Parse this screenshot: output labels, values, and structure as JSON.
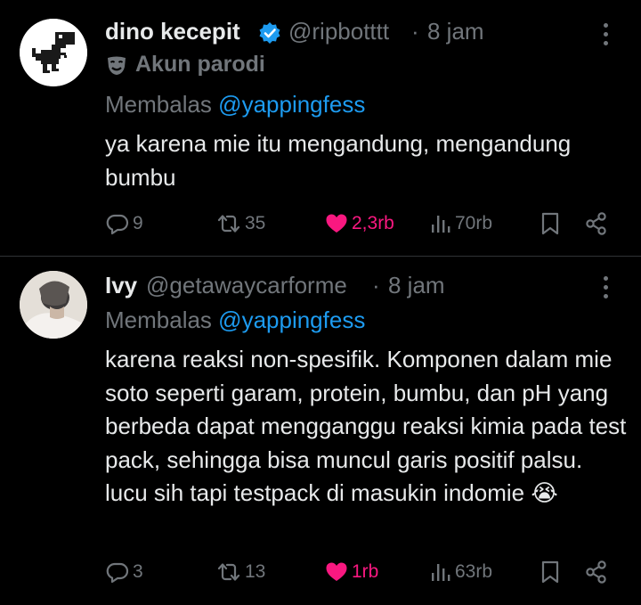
{
  "tweets": [
    {
      "name": "dino kecepit",
      "handle": "@ripbotttt",
      "separator": "·",
      "time": "8 jam",
      "verified": true,
      "label": "Akun parodi",
      "reply_prefix": "Membalas",
      "reply_to": "@yappingfess",
      "text": "ya karena mie itu mengandung, mengandung bumbu",
      "replies": "9",
      "retweets": "35",
      "likes": "2,3rb",
      "views": "70rb",
      "liked": true
    },
    {
      "name": "Ivy",
      "handle": "@getawaycarforme",
      "separator": "·",
      "time": "8 jam",
      "verified": false,
      "reply_prefix": "Membalas",
      "reply_to": "@yappingfess",
      "text": "karena reaksi non-spesifik. Komponen dalam mie soto seperti garam, protein, bumbu, dan pH yang berbeda dapat mengganggu reaksi kimia pada test pack, sehingga bisa muncul garis positif palsu. lucu sih tapi testpack di masukin indomie 😭",
      "replies": "3",
      "retweets": "13",
      "likes": "1rb",
      "views": "63rb",
      "liked": true
    }
  ],
  "colors": {
    "background": "#000000",
    "text": "#e7e9ea",
    "muted": "#71767b",
    "link": "#1d9bf0",
    "like": "#f91880",
    "verified": "#1d9bf0"
  },
  "icons": [
    "dino-avatar",
    "verified-badge-icon",
    "parody-mask-icon",
    "more-icon",
    "reply-icon",
    "retweet-icon",
    "like-icon",
    "views-icon",
    "bookmark-icon",
    "share-icon"
  ]
}
